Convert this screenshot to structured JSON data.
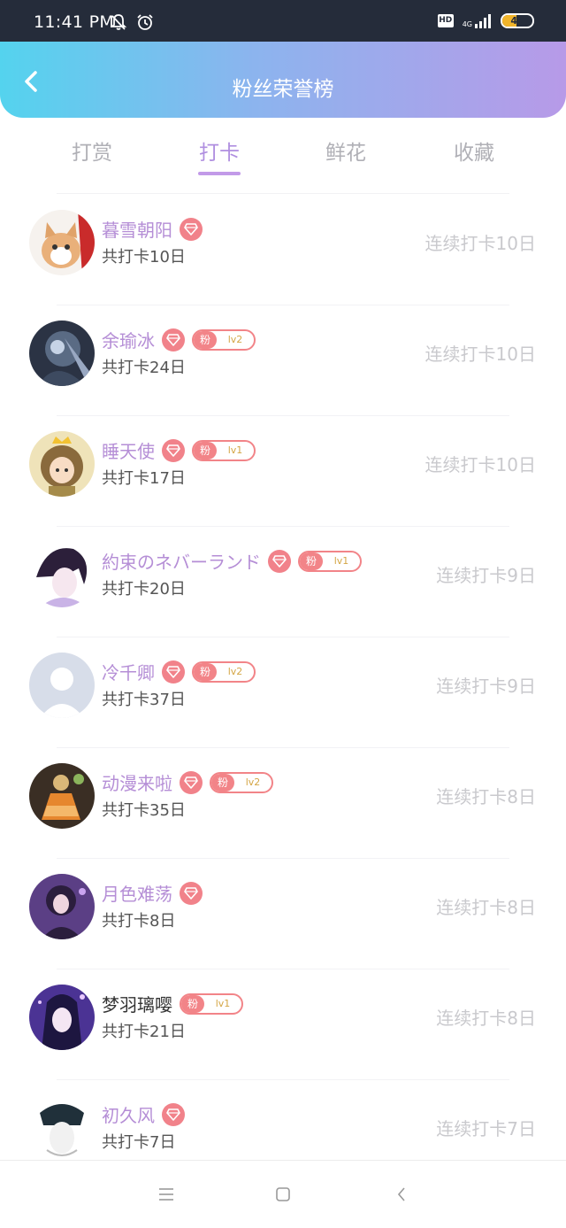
{
  "status_bar": {
    "time": "11:41 PM",
    "hd": "HD",
    "network": "4G",
    "battery": "47",
    "battery_level": 0.47
  },
  "header": {
    "title": "粉丝荣誉榜"
  },
  "tabs": [
    {
      "label": "打赏",
      "active": false
    },
    {
      "label": "打卡",
      "active": true
    },
    {
      "label": "鲜花",
      "active": false
    },
    {
      "label": "收藏",
      "active": false
    }
  ],
  "fans": [
    {
      "name": "暮雪朝阳",
      "gem": true,
      "fan_badge": null,
      "total": "共打卡10日",
      "streak": "连续打卡10日",
      "name_color": "purple",
      "avatar": "cat"
    },
    {
      "name": "余瑜冰",
      "gem": true,
      "fan_badge": {
        "label": "粉",
        "level": "lv2"
      },
      "total": "共打卡24日",
      "streak": "连续打卡10日",
      "name_color": "purple",
      "avatar": "anime-dark"
    },
    {
      "name": "睡天使",
      "gem": true,
      "fan_badge": {
        "label": "粉",
        "level": "lv1"
      },
      "total": "共打卡17日",
      "streak": "连续打卡10日",
      "name_color": "purple",
      "avatar": "anime-girl-crown"
    },
    {
      "name": "約束のネバーランド",
      "gem": true,
      "fan_badge": {
        "label": "粉",
        "level": "lv1"
      },
      "total": "共打卡20日",
      "streak": "连续打卡9日",
      "name_color": "purple",
      "avatar": "anime-boy"
    },
    {
      "name": "冷千卿",
      "gem": true,
      "fan_badge": {
        "label": "粉",
        "level": "lv2"
      },
      "total": "共打卡37日",
      "streak": "连续打卡9日",
      "name_color": "purple",
      "avatar": "default-user"
    },
    {
      "name": "动漫来啦",
      "gem": true,
      "fan_badge": {
        "label": "粉",
        "level": "lv2"
      },
      "total": "共打卡35日",
      "streak": "连续打卡8日",
      "name_color": "purple",
      "avatar": "anime-dress"
    },
    {
      "name": "月色难荡",
      "gem": true,
      "fan_badge": null,
      "total": "共打卡8日",
      "streak": "连续打卡8日",
      "name_color": "purple",
      "avatar": "anime-purple"
    },
    {
      "name": "梦羽璃嘤",
      "gem": false,
      "fan_badge": {
        "label": "粉",
        "level": "lv1"
      },
      "total": "共打卡21日",
      "streak": "连续打卡8日",
      "name_color": "dark",
      "avatar": "anime-violet"
    },
    {
      "name": "初久风",
      "gem": true,
      "fan_badge": null,
      "total": "共打卡7日",
      "streak": "连续打卡7日",
      "name_color": "purple",
      "avatar": "anime-white"
    }
  ],
  "nav": {
    "items": [
      "menu-icon",
      "home-square-icon",
      "back-chevron-icon"
    ]
  },
  "colors": {
    "accent": "#b08fe0",
    "name": "#b58ed6",
    "gem": "#f1828a",
    "header_start": "#54d3ee",
    "header_end": "#b79ae8"
  }
}
